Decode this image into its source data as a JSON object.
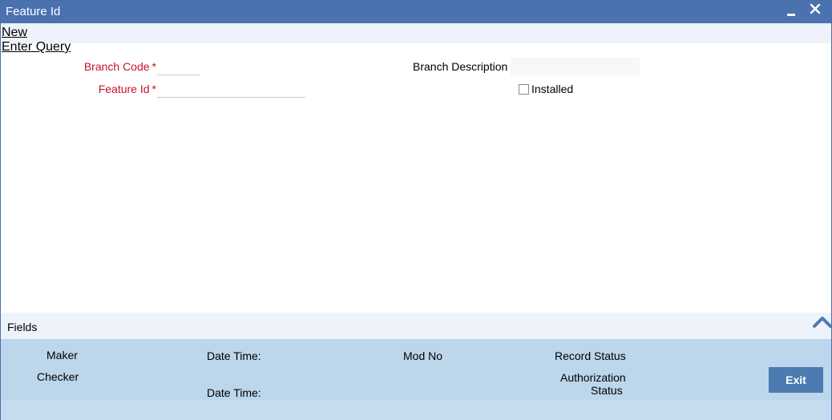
{
  "window": {
    "title": "Feature Id",
    "minimize_glyph": "▬",
    "close_glyph": "✕"
  },
  "toolbar": {
    "new_label": "New",
    "enter_query_label": "Enter Query"
  },
  "form": {
    "branch_code_label": "Branch Code",
    "branch_code_value": "",
    "feature_id_label": "Feature Id",
    "feature_id_value": "",
    "required_mark": "*",
    "branch_description_label": "Branch Description",
    "branch_description_value": "",
    "installed_label": "Installed",
    "installed_checked": false
  },
  "fields_section": {
    "label": "Fields",
    "toggle_icon": "chevron-up-icon"
  },
  "footer": {
    "maker_label": "Maker",
    "checker_label": "Checker",
    "date_time_label_1": "Date Time:",
    "date_time_label_2": "Date Time:",
    "mod_no_label": "Mod No",
    "record_status_label": "Record Status",
    "authorization_label": "Authorization",
    "status_label": "Status",
    "exit_label": "Exit"
  },
  "colors": {
    "title_bar": "#4a71b0",
    "required_label": "#c8102e",
    "footer_bg": "#bcd6ec",
    "exit_button": "#4b7bb0"
  }
}
